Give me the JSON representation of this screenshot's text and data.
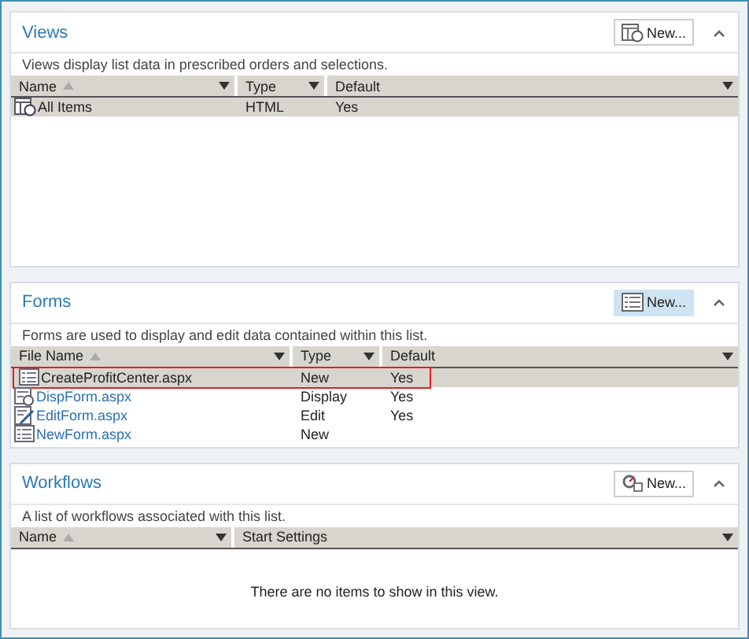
{
  "panels": [
    {
      "title": "Views",
      "new_button": {
        "label": "New...",
        "pressed": false
      },
      "description": "Views display list data in prescribed orders and selections.",
      "columns": [
        {
          "label": "Name",
          "sorted": true
        },
        {
          "label": "Type",
          "sorted": false
        },
        {
          "label": "Default",
          "sorted": false
        }
      ],
      "rows": [
        {
          "kind": "view",
          "link": false,
          "selected": true,
          "outlined": false,
          "cells": [
            "All Items",
            "HTML",
            "Yes"
          ]
        }
      ]
    },
    {
      "title": "Forms",
      "new_button": {
        "label": "New...",
        "pressed": true
      },
      "description": "Forms are used to display and edit data contained within this list.",
      "columns": [
        {
          "label": "File Name",
          "sorted": true
        },
        {
          "label": "Type",
          "sorted": false
        },
        {
          "label": "Default",
          "sorted": false
        }
      ],
      "rows": [
        {
          "kind": "form",
          "link": false,
          "selected": true,
          "outlined": true,
          "cells": [
            "CreateProfitCenter.aspx",
            "New",
            "Yes"
          ]
        },
        {
          "kind": "display-form",
          "link": true,
          "selected": false,
          "outlined": false,
          "cells": [
            "DispForm.aspx",
            "Display",
            "Yes"
          ]
        },
        {
          "kind": "edit-form",
          "link": true,
          "selected": false,
          "outlined": false,
          "cells": [
            "EditForm.aspx",
            "Edit",
            "Yes"
          ]
        },
        {
          "kind": "form",
          "link": true,
          "selected": false,
          "outlined": false,
          "cells": [
            "NewForm.aspx",
            "New",
            ""
          ]
        }
      ]
    },
    {
      "title": "Workflows",
      "new_button": {
        "label": "New...",
        "pressed": false
      },
      "description": "A list of workflows associated with this list.",
      "columns": [
        {
          "label": "Name",
          "sorted": true
        },
        {
          "label": "Start Settings",
          "sorted": false
        }
      ],
      "empty_message": "There are no items to show in this view."
    }
  ]
}
